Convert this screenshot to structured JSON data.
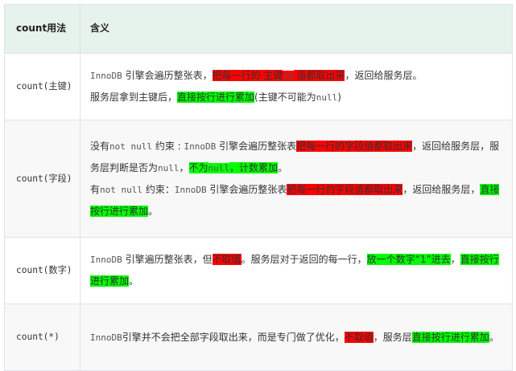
{
  "table": {
    "headers": [
      "count用法",
      "含义"
    ],
    "rows": [
      {
        "term": "count(主键)",
        "lines": [
          [
            {
              "t": "InnoDB",
              "mono": true
            },
            {
              "t": " 引擎会遍历整张表，"
            },
            {
              "t": "把每一行的 主键",
              "hl": "r"
            },
            {
              "t": "id",
              "hl": "r",
              "mono": true
            },
            {
              "t": " 值都取出来",
              "hl": "r"
            },
            {
              "t": "，返回给服务层。"
            }
          ],
          [
            {
              "t": "服务层拿到主键后，"
            },
            {
              "t": "直接按行进行累加",
              "hl": "g"
            },
            {
              "t": "(主键不可能为"
            },
            {
              "t": "null",
              "mono": true
            },
            {
              "t": ")"
            }
          ]
        ]
      },
      {
        "term": "count(字段)",
        "lines": [
          [
            {
              "t": "没有"
            },
            {
              "t": "not null",
              "mono": true
            },
            {
              "t": " 约束 : "
            },
            {
              "t": "InnoDB",
              "mono": true
            },
            {
              "t": " 引擎会遍历整张表"
            },
            {
              "t": "把每一行的字段值都取出来",
              "hl": "r"
            },
            {
              "t": "，返回给服务层，服务层判断是否为"
            },
            {
              "t": "null",
              "mono": true
            },
            {
              "t": "，"
            },
            {
              "t": "不为",
              "hl": "g"
            },
            {
              "t": "null",
              "hl": "g",
              "mono": true
            },
            {
              "t": "，计数累加",
              "hl": "g"
            },
            {
              "t": "。"
            }
          ],
          [
            {
              "t": "有"
            },
            {
              "t": "not null",
              "mono": true
            },
            {
              "t": " 约束："
            },
            {
              "t": "InnoDB",
              "mono": true
            },
            {
              "t": " 引擎会遍历整张表"
            },
            {
              "t": "把每一行的字段值都取出来",
              "hl": "r"
            },
            {
              "t": "，返回给服务层，"
            },
            {
              "t": "直接按行进行累加",
              "hl": "g"
            },
            {
              "t": "。"
            }
          ]
        ]
      },
      {
        "term": "count(数字)",
        "lines": [
          [
            {
              "t": "InnoDB",
              "mono": true
            },
            {
              "t": " 引擎遍历整张表，但"
            },
            {
              "t": "不取值",
              "hl": "r"
            },
            {
              "t": "。服务层对于返回的每一行，"
            },
            {
              "t": "放一个数字“1”进去",
              "hl": "g"
            },
            {
              "t": "，"
            },
            {
              "t": "直接按行进行累加",
              "hl": "g"
            },
            {
              "t": "。"
            }
          ]
        ]
      },
      {
        "term": "count(*)",
        "lines": [
          [
            {
              "t": "InnoDB",
              "mono": true
            },
            {
              "t": "引擎并不会把全部字段取出来，而是专门做了优化，"
            },
            {
              "t": "不取值",
              "hl": "r"
            },
            {
              "t": "，服务层"
            },
            {
              "t": "直接按行进行累加",
              "hl": "g"
            },
            {
              "t": "。"
            }
          ]
        ]
      }
    ]
  },
  "colors": {
    "header_bg": "#e6f2ec",
    "highlight_red": "#ff0000",
    "highlight_green": "#00ff00",
    "border": "#dfe2e5",
    "stripe": "#f8f8f8"
  }
}
